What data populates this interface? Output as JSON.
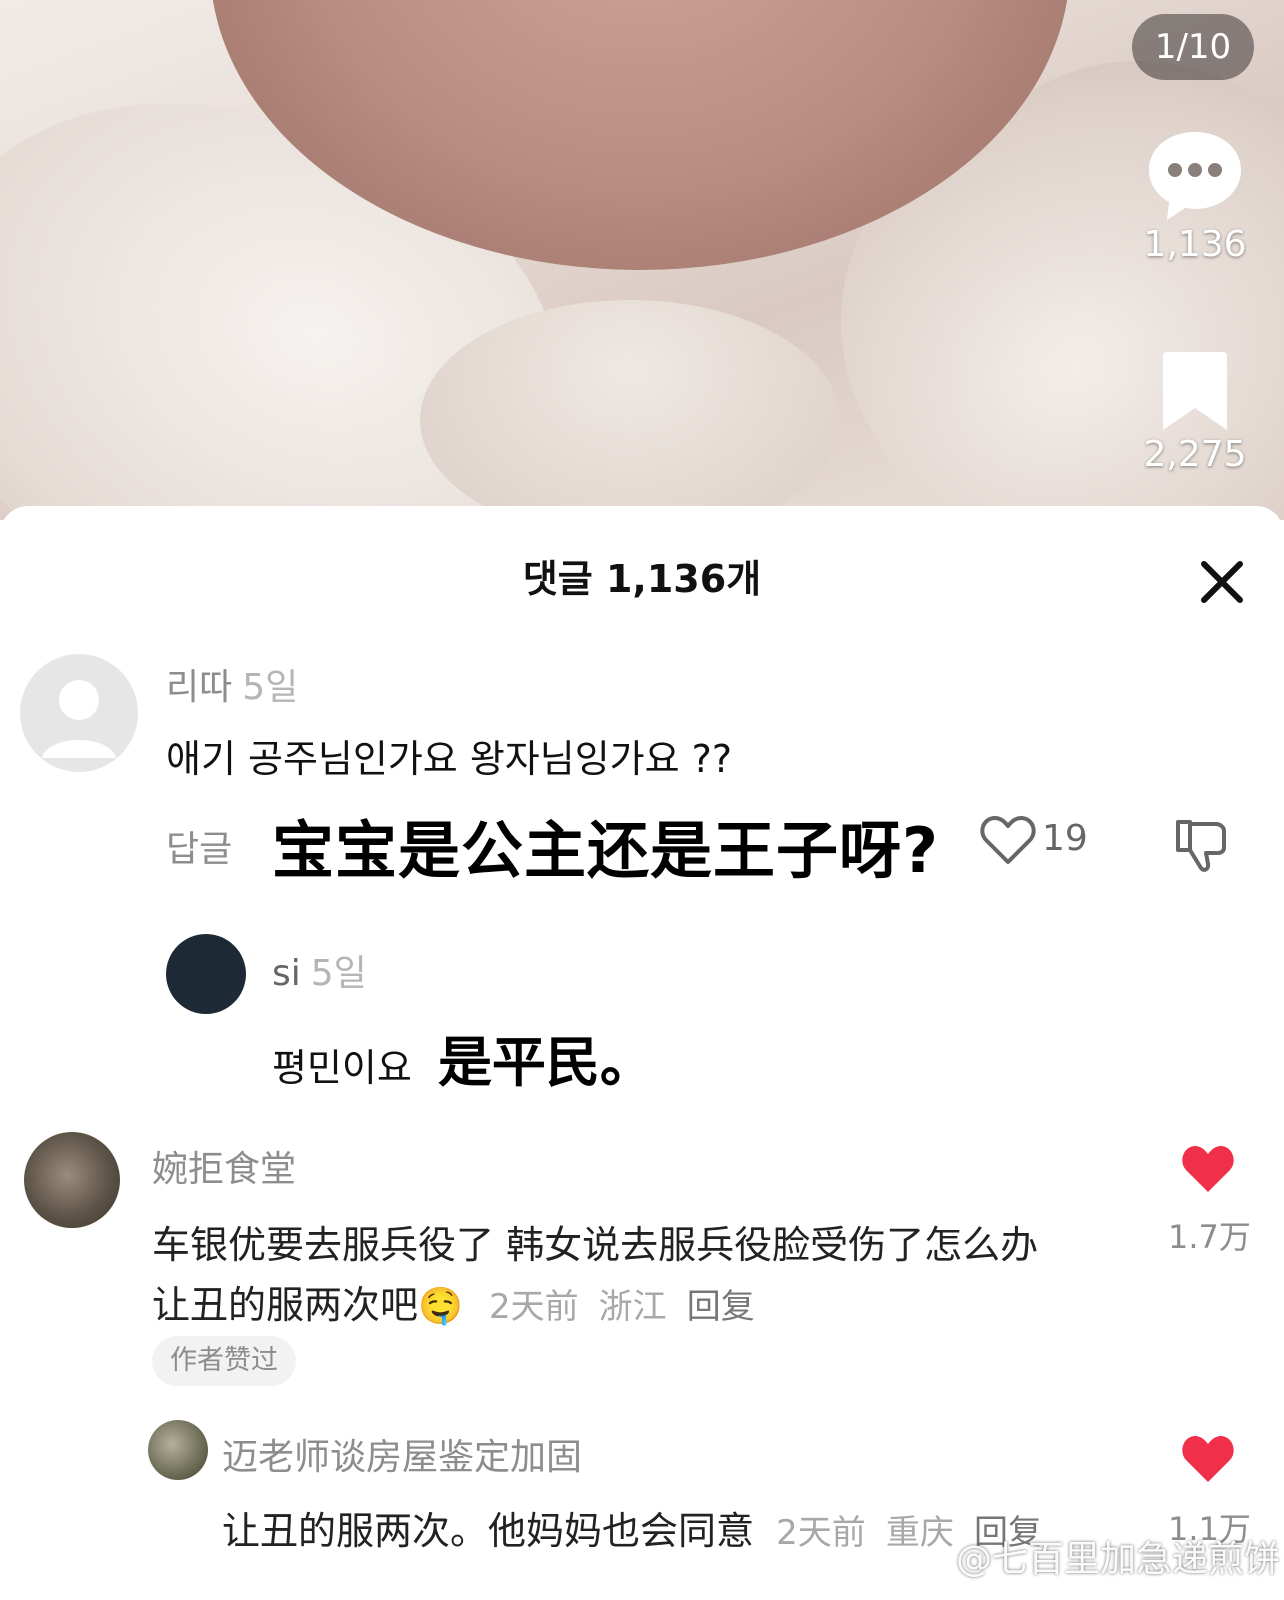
{
  "photo": {
    "counter": "1/10",
    "comment_count": "1,136",
    "bookmark_count": "2,275"
  },
  "sheet": {
    "title": "댓글 1,136개"
  },
  "comment1": {
    "user": "리따",
    "time": "5일",
    "text": "애기 공주님인가요 왕자님잉가요 ??",
    "reply_label": "답글",
    "translation": "宝宝是公主还是王子呀?",
    "likes": "19"
  },
  "comment1_reply": {
    "user": "si",
    "time": "5일",
    "text": "평민이요",
    "translation": "是平民。"
  },
  "comment2": {
    "user": "婉拒食堂",
    "line1": "车银优要去服兵役了 韩女说去服兵役脸受伤了怎么办",
    "line2": "让丑的服两次吧",
    "emoji": "🤤",
    "time": "2天前",
    "location": "浙江",
    "reply": "回复",
    "likes": "1.7万",
    "badge": "作者赞过"
  },
  "comment3": {
    "user": "迈老师谈房屋鉴定加固",
    "text": "让丑的服两次。他妈妈也会同意",
    "time": "2天前",
    "location": "重庆",
    "reply": "回复",
    "likes": "1.1万"
  },
  "watermark": "@七百里加急递煎饼",
  "colors": {
    "like_red": "#f0304a",
    "sheet_bg": "#ffffff"
  }
}
